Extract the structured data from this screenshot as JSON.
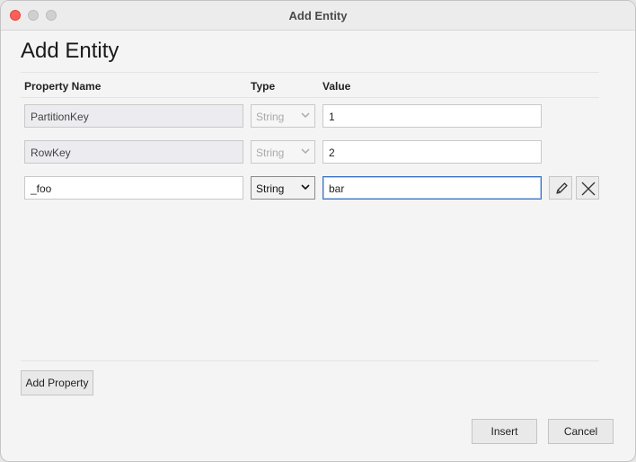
{
  "window": {
    "title": "Add Entity"
  },
  "dialog": {
    "heading": "Add Entity"
  },
  "columns": {
    "property_name": "Property Name",
    "type": "Type",
    "value": "Value"
  },
  "rows": [
    {
      "name": "PartitionKey",
      "type": "String",
      "value": "1",
      "editable": false
    },
    {
      "name": "RowKey",
      "type": "String",
      "value": "2",
      "editable": false
    },
    {
      "name": "_foo",
      "type": "String",
      "value": "bar",
      "editable": true
    }
  ],
  "actions": {
    "add_property": "Add Property",
    "insert": "Insert",
    "cancel": "Cancel"
  },
  "icons": {
    "edit": "pencil-icon",
    "delete": "close-icon",
    "dropdown": "chevron-down-icon"
  },
  "colors": {
    "focus_border": "#3a6fc4",
    "close_light": "#fe5f57"
  }
}
